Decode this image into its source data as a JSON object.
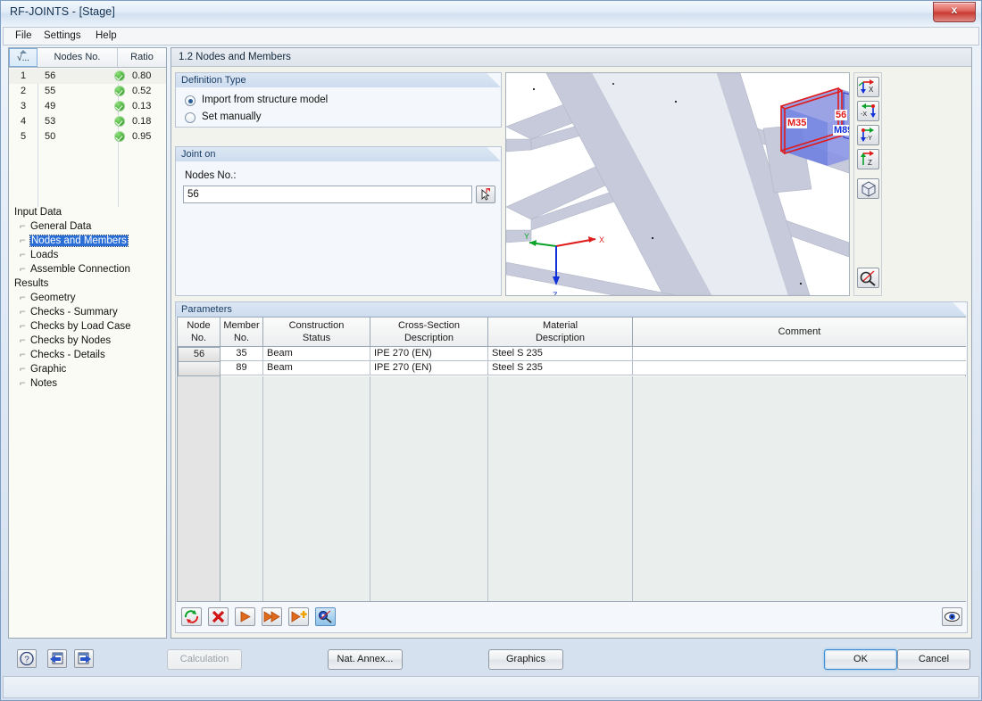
{
  "window": {
    "title": "RF-JOINTS - [Stage]",
    "close_label": "x"
  },
  "menu": {
    "items": [
      {
        "label": "File"
      },
      {
        "label": "Settings"
      },
      {
        "label": "Help"
      }
    ]
  },
  "nodes_grid": {
    "columns": [
      "√...",
      "Nodes No.",
      "Ratio"
    ],
    "rows": [
      {
        "no": "1",
        "node": "56",
        "ratio": "0.80",
        "status": "ok"
      },
      {
        "no": "2",
        "node": "55",
        "ratio": "0.52",
        "status": "ok"
      },
      {
        "no": "3",
        "node": "49",
        "ratio": "0.13",
        "status": "ok"
      },
      {
        "no": "4",
        "node": "53",
        "ratio": "0.18",
        "status": "ok"
      },
      {
        "no": "5",
        "node": "50",
        "ratio": "0.95",
        "status": "ok"
      }
    ]
  },
  "tree": {
    "input_group": "Input Data",
    "input_items": [
      {
        "label": "General Data",
        "selected": false
      },
      {
        "label": "Nodes and Members",
        "selected": true
      },
      {
        "label": "Loads",
        "selected": false
      },
      {
        "label": "Assemble Connection",
        "selected": false
      }
    ],
    "results_group": "Results",
    "results_items": [
      {
        "label": "Geometry"
      },
      {
        "label": "Checks - Summary"
      },
      {
        "label": "Checks by Load Case"
      },
      {
        "label": "Checks by Nodes"
      },
      {
        "label": "Checks - Details"
      },
      {
        "label": "Graphic"
      },
      {
        "label": "Notes"
      }
    ]
  },
  "page": {
    "title": "1.2 Nodes and Members"
  },
  "definition_type": {
    "title": "Definition Type",
    "options": [
      {
        "label": "Import from structure model",
        "selected": true
      },
      {
        "label": "Set manually",
        "selected": false
      }
    ]
  },
  "joint_on": {
    "title": "Joint on",
    "field_label": "Nodes No.:",
    "value": "56",
    "placeholder": ""
  },
  "viewport": {
    "labels": {
      "member_left": "M35",
      "member_right": "M89",
      "node": "56"
    },
    "axes": {
      "x": "X",
      "y": "Y",
      "z": "Z"
    },
    "colors": {
      "beam": "#c6cada",
      "member_red": "#e01b1b",
      "member_blue": "#6f7fe0"
    },
    "toolbar": [
      {
        "name": "view-x",
        "label": "X"
      },
      {
        "name": "view-minus-x",
        "label": "-X"
      },
      {
        "name": "view-minus-y",
        "label": "-Y"
      },
      {
        "name": "view-z",
        "label": "Z"
      },
      {
        "name": "view-isometric",
        "label": ""
      },
      {
        "name": "zoom-tool",
        "label": ""
      }
    ]
  },
  "parameters": {
    "title": "Parameters",
    "columns": [
      {
        "line1": "Node",
        "line2": "No."
      },
      {
        "line1": "Member",
        "line2": "No."
      },
      {
        "line1": "Construction",
        "line2": "Status"
      },
      {
        "line1": "Cross-Section",
        "line2": "Description"
      },
      {
        "line1": "Material",
        "line2": "Description"
      },
      {
        "line1": "Comment",
        "line2": ""
      }
    ],
    "rows": [
      {
        "node": "56",
        "member": "35",
        "construction": "Beam",
        "section": "IPE 270 (EN)",
        "material": "Steel S 235",
        "comment": ""
      },
      {
        "node": "",
        "member": "89",
        "construction": "Beam",
        "section": "IPE 270 (EN)",
        "material": "Steel S 235",
        "comment": ""
      }
    ],
    "toolbar": [
      {
        "name": "refresh-button"
      },
      {
        "name": "delete-button"
      },
      {
        "name": "apply-button"
      },
      {
        "name": "apply-all-button"
      },
      {
        "name": "add-button"
      },
      {
        "name": "pick-button"
      }
    ],
    "visibility_button": "eye-icon"
  },
  "bottom_bar": {
    "help_button": "?",
    "prev_button": "",
    "next_button": "",
    "buttons": [
      {
        "name": "calculation-button",
        "label": "Calculation",
        "disabled": true
      },
      {
        "name": "nat-annex-button",
        "label": "Nat. Annex...",
        "disabled": false
      },
      {
        "name": "graphics-button",
        "label": "Graphics",
        "disabled": false
      }
    ],
    "ok_label": "OK",
    "cancel_label": "Cancel"
  }
}
